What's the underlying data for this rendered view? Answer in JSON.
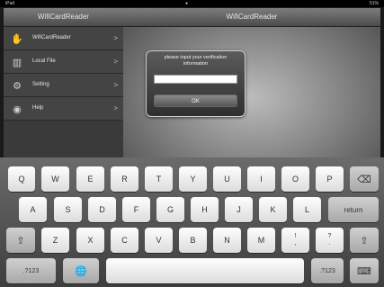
{
  "status_bar": {
    "left": "iPad",
    "center": "●",
    "right": "51%"
  },
  "sidebar": {
    "title": "WifiCardReader",
    "items": [
      {
        "label": "WifiCardReader",
        "icon": "hand-icon",
        "glyph": "✋",
        "chevron": ">"
      },
      {
        "label": "Local File",
        "icon": "library-icon",
        "glyph": "▥",
        "chevron": ">"
      },
      {
        "label": "Setting",
        "icon": "settings-icon",
        "glyph": "⚙",
        "chevron": ">"
      },
      {
        "label": "Help",
        "icon": "help-icon",
        "glyph": "◉",
        "chevron": ">"
      }
    ]
  },
  "main": {
    "title": "WifiCardReader"
  },
  "dialog": {
    "title_line1": "please input your verification",
    "title_line2": "information",
    "input_value": "",
    "ok_label": "OK"
  },
  "keyboard": {
    "row1": [
      "Q",
      "W",
      "E",
      "R",
      "T",
      "Y",
      "U",
      "I",
      "O",
      "P"
    ],
    "backspace": "⌫",
    "row2": [
      "A",
      "S",
      "D",
      "F",
      "G",
      "H",
      "J",
      "K",
      "L"
    ],
    "return_label": "return",
    "shift": "⇧",
    "row3": [
      "Z",
      "X",
      "C",
      "V",
      "B",
      "N",
      "M"
    ],
    "punct1": {
      "top": "!",
      "bottom": ","
    },
    "punct2": {
      "top": "?",
      "bottom": "."
    },
    "numbers_label": ".?123",
    "globe": "🌐",
    "space_label": "",
    "hide_keyboard": "⌨"
  },
  "colors": {
    "accent": "#4b4b4b",
    "key_face": "#f5f5f5"
  }
}
